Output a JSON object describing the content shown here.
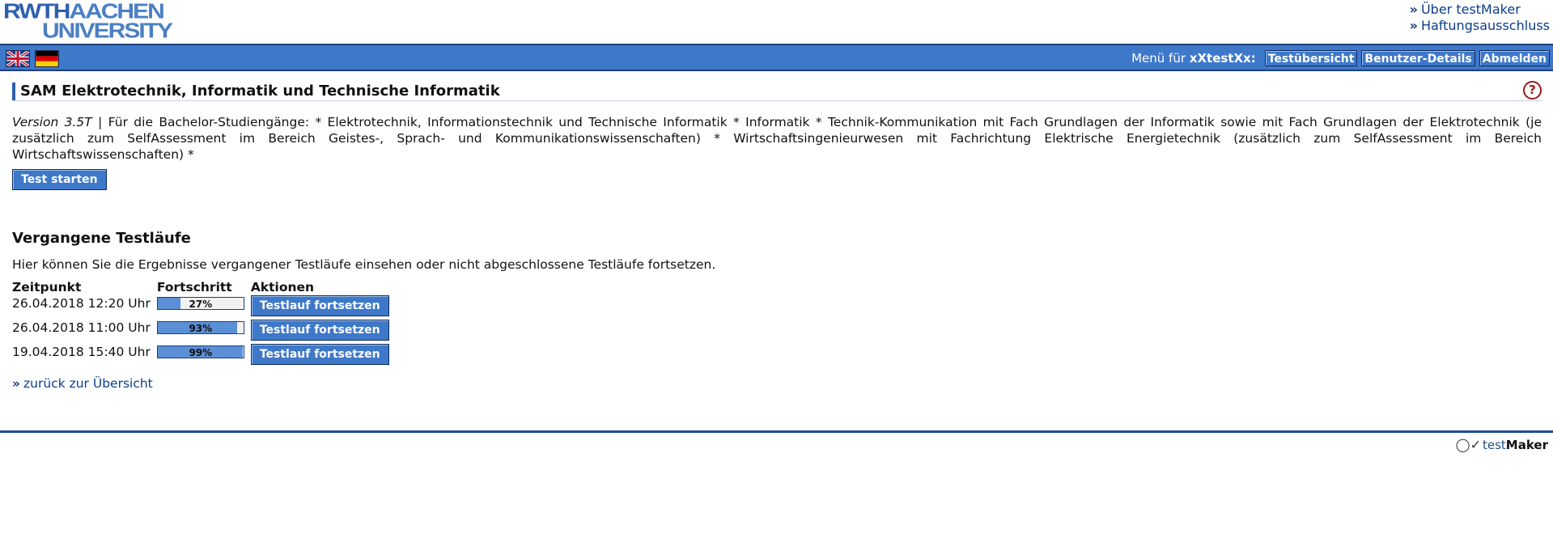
{
  "logo": {
    "line1_a": "RWTH",
    "line1_b": "AACHEN",
    "line2": "UNIVERSITY"
  },
  "top_links": [
    "Über testMaker",
    "Haftungsausschluss"
  ],
  "menubar": {
    "label_prefix": "Menü für",
    "username": "xXtestXx:",
    "buttons": [
      "Testübersicht",
      "Benutzer-Details",
      "Abmelden"
    ]
  },
  "page": {
    "title": "SAM Elektrotechnik, Informatik und Technische Informatik",
    "version": "Version 3.5T",
    "description": " | Für die Bachelor-Studiengänge: * Elektrotechnik, Informationstechnik und Technische Informatik * Informatik * Technik-Kommunikation mit Fach Grundlagen der Informatik sowie mit Fach Grundlagen der Elektrotechnik (je zusätzlich zum SelfAssessment im Bereich Geistes-, Sprach- und Kommunikationswissenschaften) * Wirtschaftsingenieurwesen mit Fachrichtung Elektrische Energietechnik (zusätzlich zum SelfAssessment im Bereich Wirtschaftswissenschaften) *",
    "start_button": "Test starten"
  },
  "past_runs": {
    "heading": "Vergangene Testläufe",
    "info": "Hier können Sie die Ergebnisse vergangener Testläufe einsehen oder nicht abgeschlossene Testläufe fortsetzen.",
    "columns": [
      "Zeitpunkt",
      "Fortschritt",
      "Aktionen"
    ],
    "rows": [
      {
        "time": "26.04.2018 12:20 Uhr",
        "progress": 27,
        "progress_label": "27%",
        "action": "Testlauf fortsetzen"
      },
      {
        "time": "26.04.2018 11:00 Uhr",
        "progress": 93,
        "progress_label": "93%",
        "action": "Testlauf fortsetzen"
      },
      {
        "time": "19.04.2018 15:40 Uhr",
        "progress": 99,
        "progress_label": "99%",
        "action": "Testlauf fortsetzen"
      }
    ]
  },
  "back_link": "zurück zur Übersicht",
  "footer": {
    "brand_a": "test",
    "brand_b": "Maker"
  },
  "colors": {
    "primary": "#3e78c9",
    "dark": "#1d3f7a",
    "help": "#9a1a1a"
  },
  "icons": [
    "uk-flag-icon",
    "de-flag-icon",
    "help-icon",
    "testmaker-logo-icon"
  ]
}
